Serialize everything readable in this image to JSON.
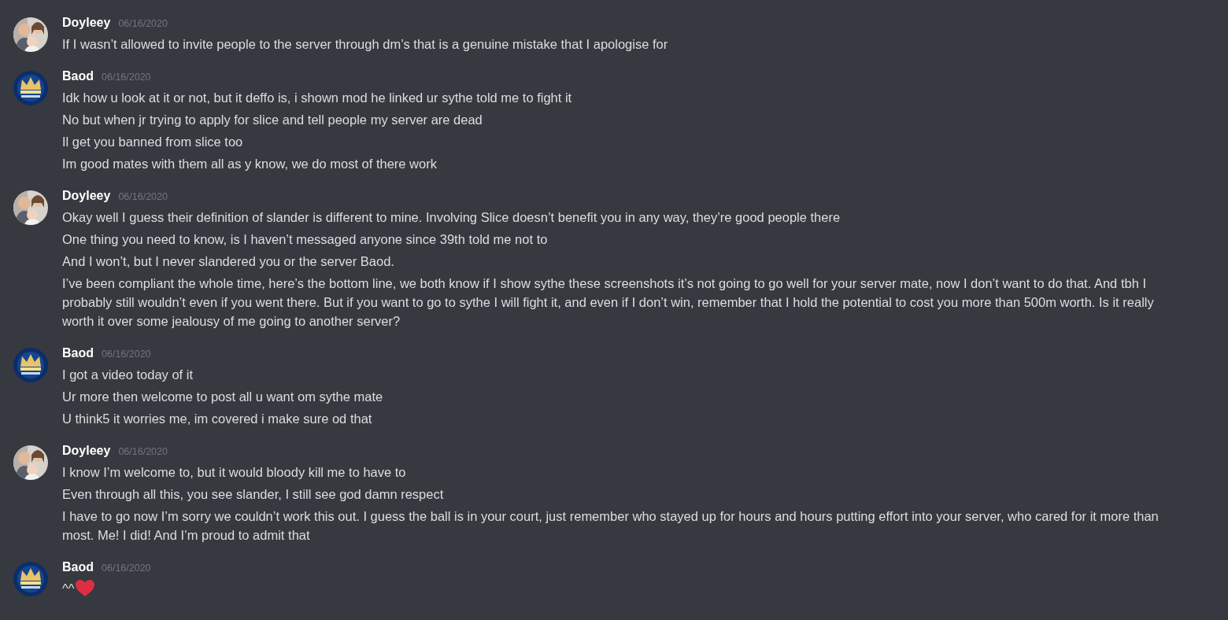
{
  "messages": [
    {
      "author": "Doyleey",
      "avatar": {
        "kind": "picture"
      },
      "timestamp": "06/16/2020",
      "lines": [
        {
          "kind": "text",
          "text": "If I wasn’t allowed to invite people to the server through dm’s that is a genuine mistake that I apologise for"
        }
      ]
    },
    {
      "author": "Baod",
      "avatar": {
        "kind": "icon"
      },
      "timestamp": "06/16/2020",
      "lines": [
        {
          "kind": "text",
          "text": "Idk how u look at it or not, but it deffo is, i shown mod he linked ur sythe told me to fight it"
        },
        {
          "kind": "text",
          "text": "No but when jr trying to apply for slice and tell people my server are dead"
        },
        {
          "kind": "text",
          "text": "Il get you banned from slice too"
        },
        {
          "kind": "text",
          "text": "Im good mates with them all as y know, we do most of there work"
        }
      ]
    },
    {
      "author": "Doyleey",
      "avatar": {
        "kind": "picture"
      },
      "timestamp": "06/16/2020",
      "lines": [
        {
          "kind": "text",
          "text": "Okay well I guess their definition of slander is different to mine. Involving Slice doesn’t benefit you in any way, they’re good people there"
        },
        {
          "kind": "text",
          "text": "One thing you need to know, is I haven’t messaged anyone since 39th told me not to"
        },
        {
          "kind": "text",
          "text": "And I won’t, but I never slandered you or the server Baod."
        },
        {
          "kind": "text",
          "text": "I’ve been compliant the whole time, here’s the bottom line, we both know if I show sythe these screenshots it’s not going to go well for your server mate, now I don’t want to do that. And tbh I probably still wouldn’t even if you went there. But if you want to go to sythe I will fight it, and even if I don’t win, remember that I hold the potential to cost you more than 500m worth. Is it really worth it over some jealousy of me going to another server?"
        }
      ]
    },
    {
      "author": "Baod",
      "avatar": {
        "kind": "icon"
      },
      "timestamp": "06/16/2020",
      "lines": [
        {
          "kind": "text",
          "text": "I got a video today of it"
        },
        {
          "kind": "text",
          "text": "Ur more then welcome to post all u want om sythe mate"
        },
        {
          "kind": "text",
          "text": "U think5 it worries me, im covered i make sure od that"
        }
      ]
    },
    {
      "author": "Doyleey",
      "avatar": {
        "kind": "picture"
      },
      "timestamp": "06/16/2020",
      "lines": [
        {
          "kind": "text",
          "text": "I know I’m welcome to, but it would bloody kill me to have to"
        },
        {
          "kind": "text",
          "text": "Even through all this, you see slander, I still see god damn respect"
        },
        {
          "kind": "text",
          "text": "I have to go now I’m sorry we couldn’t work this out. I guess the ball is in your court, just remember who stayed up for hours and hours putting effort into your server, who cared for it more than most. Me! I did! And I’m proud to admit that"
        }
      ]
    },
    {
      "author": "Baod",
      "avatar": {
        "kind": "icon"
      },
      "timestamp": "06/16/2020",
      "lines": [
        {
          "kind": "emoji",
          "text": "^^"
        }
      ]
    }
  ]
}
